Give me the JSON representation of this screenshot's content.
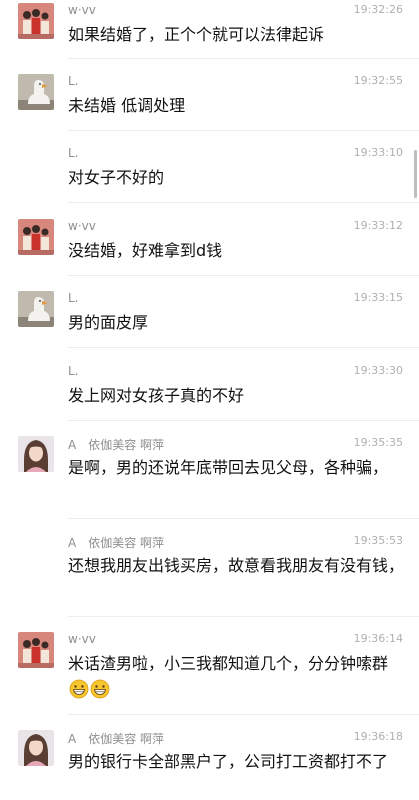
{
  "messages": [
    {
      "avatar": "family-illustration-avatar",
      "name": "w·vv",
      "time": "19:32:26",
      "text": "如果结婚了，正个个就可以法律起诉"
    },
    {
      "avatar": "goose-photo-avatar",
      "name": "L.",
      "time": "19:32:55",
      "text": "未结婚 低调处理"
    },
    {
      "avatar": "",
      "name": "L.",
      "time": "19:33:10",
      "text": "对女子不好的"
    },
    {
      "avatar": "family-illustration-avatar",
      "name": "w·vv",
      "time": "19:33:12",
      "text": "没结婚，好难拿到d钱"
    },
    {
      "avatar": "goose-photo-avatar",
      "name": "L.",
      "time": "19:33:15",
      "text": "男的面皮厚"
    },
    {
      "avatar": "",
      "name": "L.",
      "time": "19:33:30",
      "text": "发上网对女孩子真的不好"
    },
    {
      "avatar": "woman-photo-avatar",
      "name": "A　依伽美容 啊萍",
      "time": "19:35:35",
      "text": "是啊，男的还说年底带回去见父母，各种骗，"
    },
    {
      "avatar": "",
      "name": "A　依伽美容 啊萍",
      "time": "19:35:53",
      "text": "还想我朋友出钱买房，故意看我朋友有没有钱，"
    },
    {
      "avatar": "family-illustration-avatar",
      "name": "w·vv",
      "time": "19:36:14",
      "text": "米话渣男啦，小三我都知道几个，分分钟嗦群",
      "emoji": [
        "grinning-emoji",
        "grinning-emoji"
      ]
    },
    {
      "avatar": "woman-photo-avatar",
      "name": "A　依伽美容 啊萍",
      "time": "19:36:18",
      "text": "男的银行卡全部黑户了，公司打工资都打不了"
    }
  ]
}
